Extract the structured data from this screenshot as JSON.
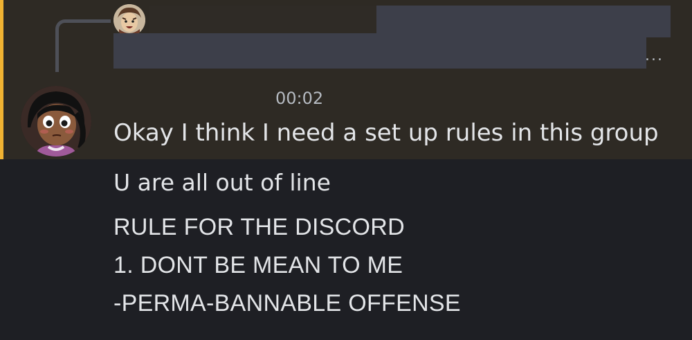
{
  "reply": {
    "ellipsis": "...",
    "avatar_icon": "reply-avatar-icon"
  },
  "message": {
    "timestamp": "00:02",
    "avatar_icon": "user-avatar-icon",
    "lines": [
      "Okay I think I need a set up rules in this group",
      "U are all out of line",
      "RULE FOR THE DISCORD",
      "1.  DONT BE MEAN TO ME",
      "-PERMA-BANNABLE OFFENSE"
    ]
  },
  "colors": {
    "highlight_bg": "#2e2a24",
    "highlight_bar": "#f0b232",
    "background": "#1e1f24",
    "text": "#e3e5e8",
    "muted": "#b5bac1"
  }
}
